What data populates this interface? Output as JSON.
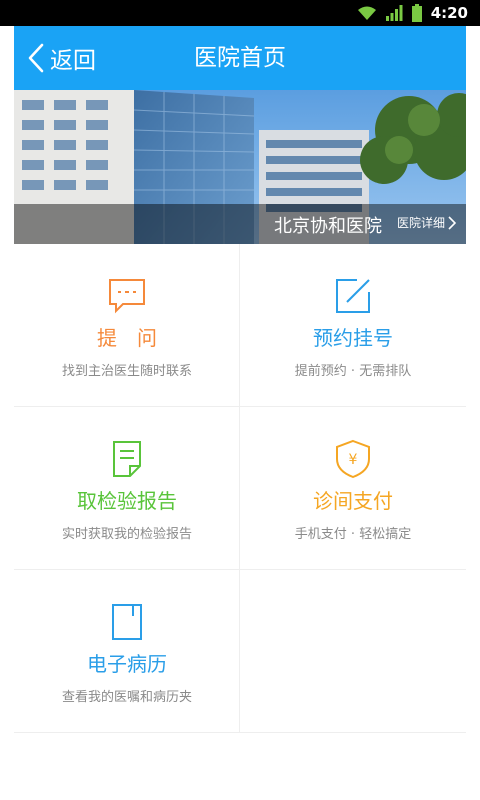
{
  "status_bar": {
    "time": "4:20",
    "icons": [
      "wifi-icon",
      "signal-icon",
      "battery-icon"
    ]
  },
  "nav": {
    "back_label": "返回",
    "title": "医院首页"
  },
  "hero": {
    "hospital_name": "北京协和医院",
    "detail_link": "医院详细"
  },
  "colors": {
    "nav_blue": "#1aa3f5",
    "orange": "#f5893a",
    "blue": "#2a9ee8",
    "green": "#59c43a",
    "amber": "#f5a623"
  },
  "services": [
    {
      "title": "提　问",
      "subtitle": "找到主治医生随时联系",
      "icon": "chat-bubble-icon",
      "color": "#f5893a"
    },
    {
      "title": "预约挂号",
      "subtitle": "提前预约 · 无需排队",
      "icon": "edit-icon",
      "color": "#2a9ee8"
    },
    {
      "title": "取检验报告",
      "subtitle": "实时获取我的检验报告",
      "icon": "report-icon",
      "color": "#59c43a"
    },
    {
      "title": "诊间支付",
      "subtitle": "手机支付 · 轻松搞定",
      "icon": "yuan-shield-icon",
      "color": "#f5a623"
    },
    {
      "title": "电子病历",
      "subtitle": "查看我的医嘱和病历夹",
      "icon": "medical-record-icon",
      "color": "#2a9ee8"
    }
  ]
}
